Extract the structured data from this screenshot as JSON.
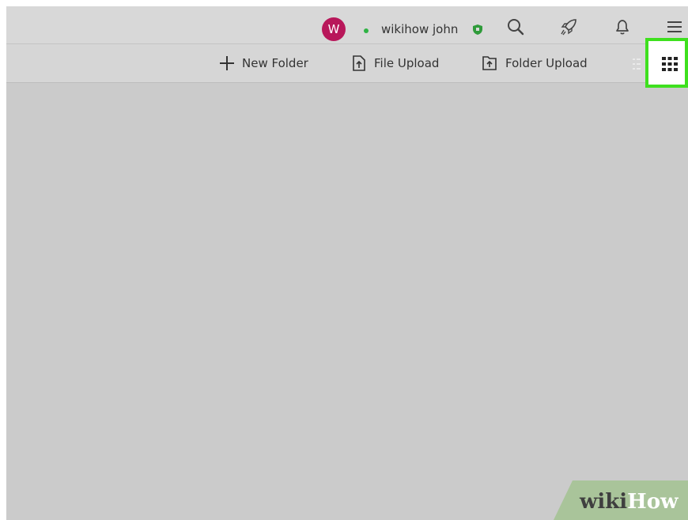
{
  "header": {
    "avatar_letter": "W",
    "status_color": "#2fb344",
    "username": "wikihow john",
    "icons": [
      "shield-icon",
      "search-icon",
      "rocket-icon",
      "bell-icon",
      "menu-icon"
    ]
  },
  "toolbar": {
    "new_folder_label": "New Folder",
    "file_upload_label": "File Upload",
    "folder_upload_label": "Folder Upload",
    "views": [
      "list-view-icon",
      "grid-view-icon"
    ],
    "highlight_color": "#3ee01e"
  },
  "watermark": {
    "part1": "wiki",
    "part2": "How"
  }
}
